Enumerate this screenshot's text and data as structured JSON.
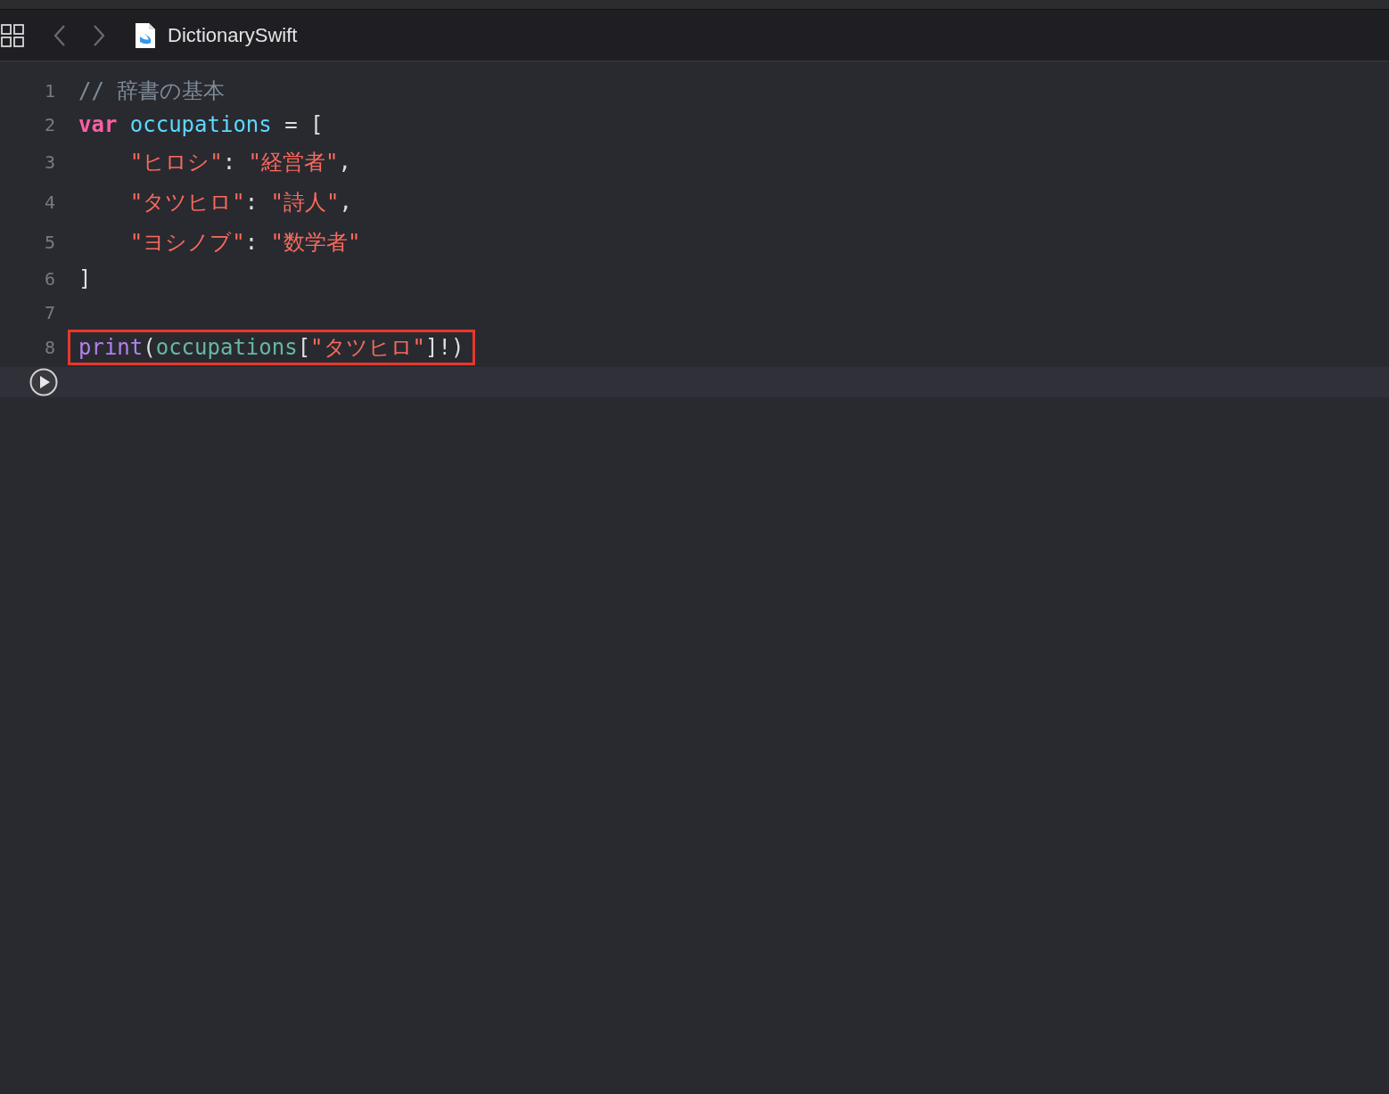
{
  "toolbar": {
    "file_name": "DictionarySwift"
  },
  "code_lines": [
    {
      "number": "1",
      "highlighted": false,
      "tokens": [
        {
          "kind": "comment",
          "text": "// 辞書の基本"
        }
      ]
    },
    {
      "number": "2",
      "highlighted": false,
      "tokens": [
        {
          "kind": "keyword",
          "text": "var"
        },
        {
          "kind": "identifier",
          "text": " occupations"
        },
        {
          "kind": "plain",
          "text": " = ["
        }
      ]
    },
    {
      "number": "3",
      "highlighted": false,
      "tokens": [
        {
          "kind": "string",
          "text": "    \"ヒロシ\""
        },
        {
          "kind": "plain",
          "text": ": "
        },
        {
          "kind": "string",
          "text": "\"経営者\""
        },
        {
          "kind": "plain",
          "text": ","
        }
      ]
    },
    {
      "number": "4",
      "highlighted": false,
      "tokens": [
        {
          "kind": "string",
          "text": "    \"タツヒロ\""
        },
        {
          "kind": "plain",
          "text": ": "
        },
        {
          "kind": "string",
          "text": "\"詩人\""
        },
        {
          "kind": "plain",
          "text": ","
        }
      ]
    },
    {
      "number": "5",
      "highlighted": false,
      "tokens": [
        {
          "kind": "string",
          "text": "    \"ヨシノブ\""
        },
        {
          "kind": "plain",
          "text": ": "
        },
        {
          "kind": "string",
          "text": "\"数学者\""
        }
      ]
    },
    {
      "number": "6",
      "highlighted": false,
      "tokens": [
        {
          "kind": "plain",
          "text": "]"
        }
      ]
    },
    {
      "number": "7",
      "highlighted": false
    },
    {
      "number": "8",
      "highlighted": true,
      "tokens": [
        {
          "kind": "function",
          "text": "print"
        },
        {
          "kind": "plain",
          "text": "("
        },
        {
          "kind": "property",
          "text": "occupations"
        },
        {
          "kind": "plain",
          "text": "["
        },
        {
          "kind": "string",
          "text": "\"タツヒロ\""
        },
        {
          "kind": "plain",
          "text": "]!)"
        }
      ]
    }
  ]
}
